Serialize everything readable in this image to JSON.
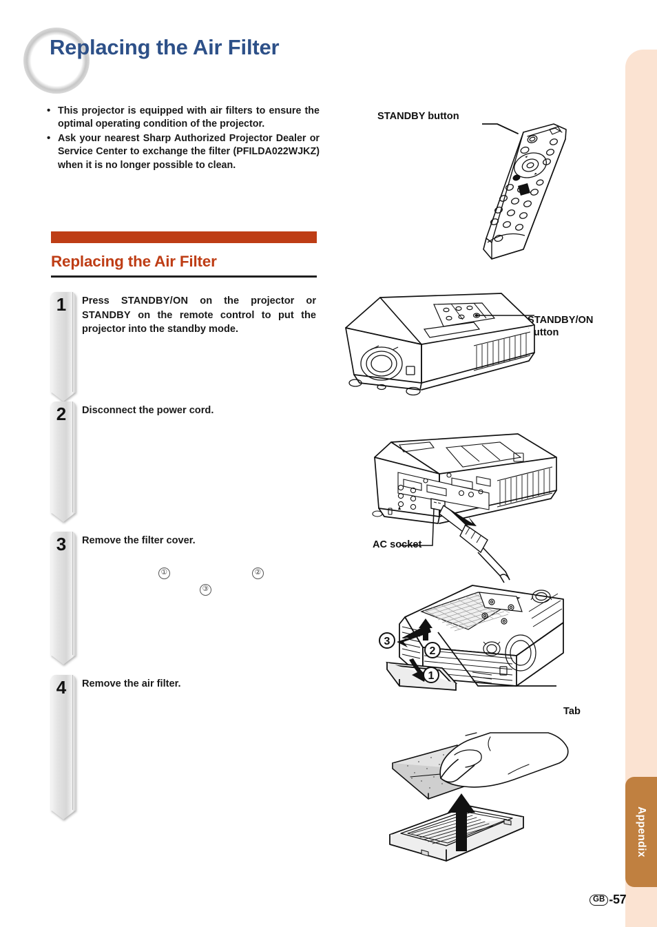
{
  "document": {
    "title": "Replacing the Air Filter",
    "page_number": "-57",
    "region_code": "GB",
    "side_tab_label": "Appendix"
  },
  "colors": {
    "title_blue": "#2d5088",
    "accent_orange": "#be3d15",
    "side_band_peach": "#fbe3d2",
    "tab_brown": "#c08040"
  },
  "intro": {
    "bullets": [
      "This projector is equipped with air filters to ensure the optimal operating condition of the projector.",
      "Ask your nearest Sharp Authorized Projector Dealer or Service Center to exchange the filter (PFILDA022WJKZ) when it is no longer possible to clean."
    ]
  },
  "section": {
    "heading": "Replacing the Air Filter"
  },
  "steps": [
    {
      "number": "1",
      "text_parts": {
        "a": "Press ",
        "b": "STANDBY/ON",
        "c": " on the projector or ",
        "d": "STANDBY",
        "e": " on the remote control to put the projector into the standby mode."
      },
      "plain": "Press STANDBY/ON on the projector or STANDBY on the remote control to put the projector into the standby mode."
    },
    {
      "number": "2",
      "plain": "Disconnect the power cord."
    },
    {
      "number": "3",
      "plain": "Remove the filter cover."
    },
    {
      "number": "4",
      "plain": "Remove the air filter."
    }
  ],
  "step3_markers": [
    {
      "label": "①"
    },
    {
      "label": "②"
    },
    {
      "label": "③"
    }
  ],
  "callouts": {
    "standby_button": "STANDBY button",
    "standby_on_button": "STANDBY/ON\nbutton",
    "ac_socket": "AC socket",
    "tab": "Tab"
  },
  "figure_markers": {
    "three": "3",
    "two": "2",
    "one": "1"
  }
}
